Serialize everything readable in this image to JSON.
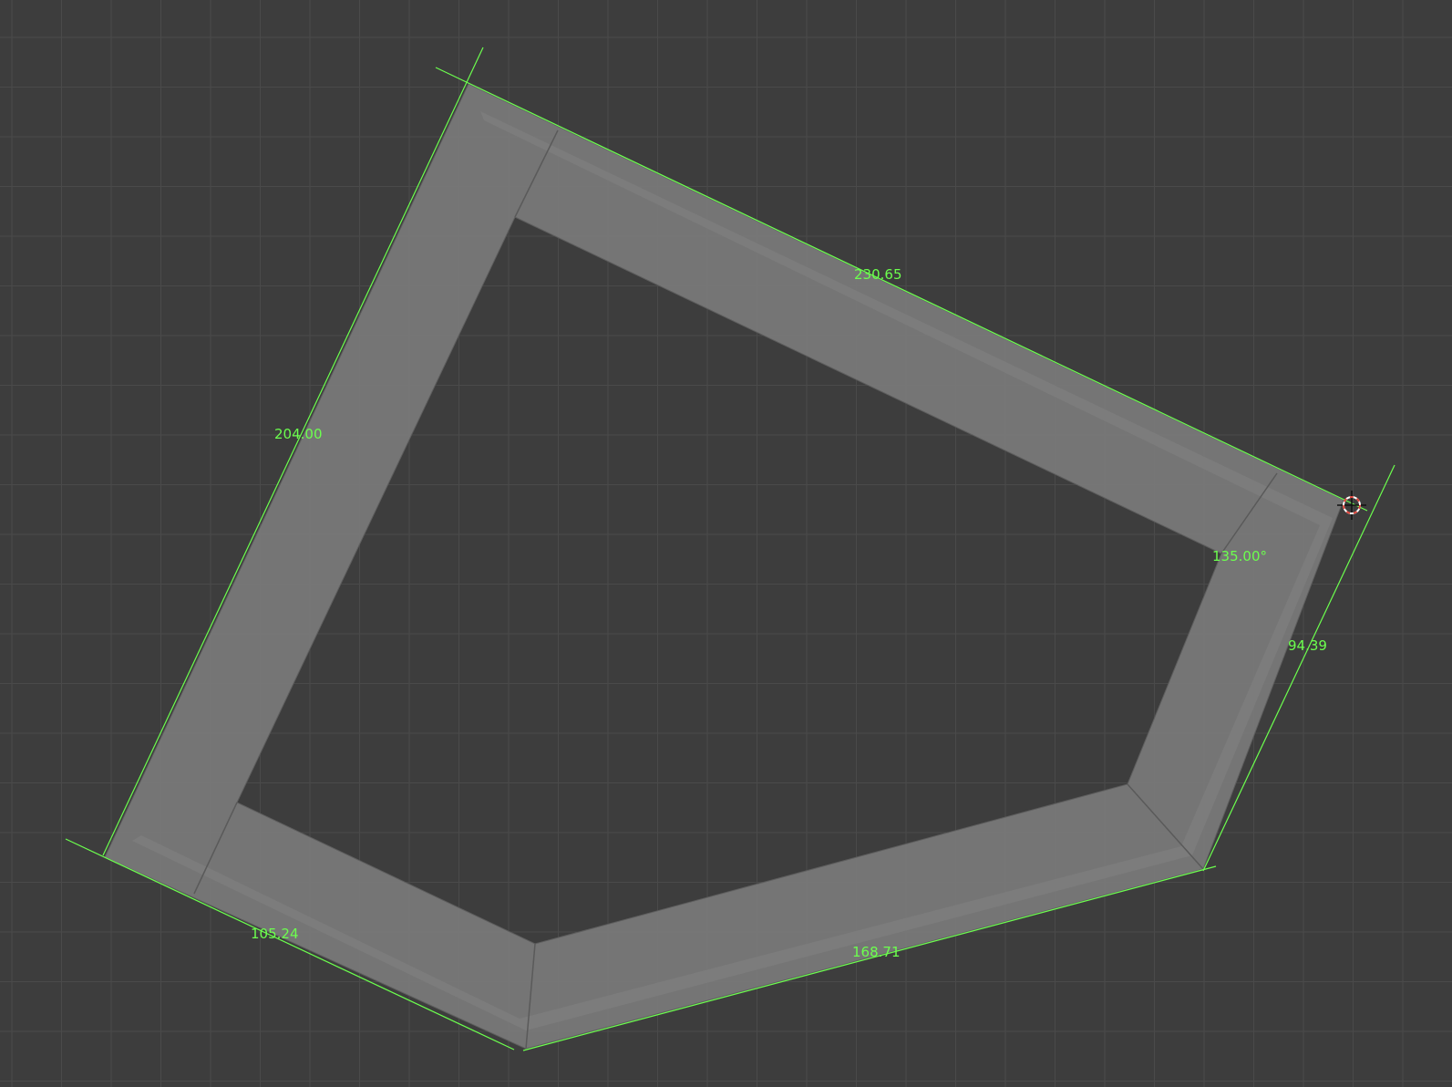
{
  "viewport": {
    "name": "3D Viewport - top orthographic",
    "background": "#3d3d3d",
    "grid_color": "#4a4a4a",
    "wall_color": "#7a7a7a",
    "edge_color": "#5a5a5a",
    "measure_color": "#6cff4e"
  },
  "measurements": {
    "edge_top": "230.65",
    "edge_left": "204.00",
    "edge_right": "94.39",
    "edge_bottom_left": "105.24",
    "edge_bottom_right": "168.71",
    "angle_right": "135.00°"
  },
  "cursor": {
    "name": "3d-cursor-icon"
  }
}
